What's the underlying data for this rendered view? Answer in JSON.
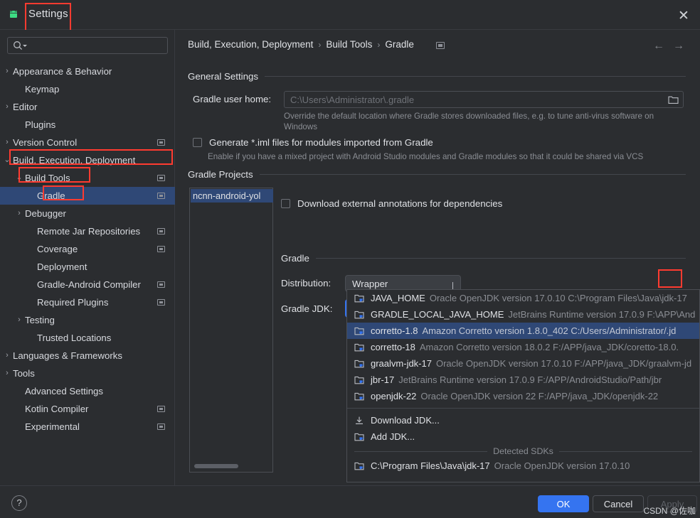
{
  "window": {
    "title": "Settings",
    "close_label": "✕",
    "app_icon": "android-logo-icon"
  },
  "search": {
    "placeholder": "",
    "value": ""
  },
  "sidebar": {
    "items": [
      {
        "label": "Appearance & Behavior",
        "arrow": "›",
        "indent": 18,
        "page_icon": false,
        "selected": false
      },
      {
        "label": "Keymap",
        "arrow": "",
        "indent": 35,
        "page_icon": false,
        "selected": false
      },
      {
        "label": "Editor",
        "arrow": "›",
        "indent": 18,
        "page_icon": false,
        "selected": false
      },
      {
        "label": "Plugins",
        "arrow": "",
        "indent": 35,
        "page_icon": false,
        "selected": false
      },
      {
        "label": "Version Control",
        "arrow": "›",
        "indent": 18,
        "page_icon": true,
        "selected": false
      },
      {
        "label": "Build, Execution, Deployment",
        "arrow": "⌄",
        "indent": 18,
        "page_icon": false,
        "selected": false
      },
      {
        "label": "Build Tools",
        "arrow": "⌄",
        "indent": 35,
        "page_icon": true,
        "selected": false
      },
      {
        "label": "Gradle",
        "arrow": "",
        "indent": 52,
        "page_icon": true,
        "selected": true
      },
      {
        "label": "Debugger",
        "arrow": "›",
        "indent": 35,
        "page_icon": false,
        "selected": false
      },
      {
        "label": "Remote Jar Repositories",
        "arrow": "",
        "indent": 52,
        "page_icon": true,
        "selected": false
      },
      {
        "label": "Coverage",
        "arrow": "",
        "indent": 52,
        "page_icon": true,
        "selected": false
      },
      {
        "label": "Deployment",
        "arrow": "",
        "indent": 52,
        "page_icon": false,
        "selected": false
      },
      {
        "label": "Gradle-Android Compiler",
        "arrow": "",
        "indent": 52,
        "page_icon": true,
        "selected": false
      },
      {
        "label": "Required Plugins",
        "arrow": "",
        "indent": 52,
        "page_icon": true,
        "selected": false
      },
      {
        "label": "Testing",
        "arrow": "›",
        "indent": 35,
        "page_icon": false,
        "selected": false
      },
      {
        "label": "Trusted Locations",
        "arrow": "",
        "indent": 52,
        "page_icon": false,
        "selected": false
      },
      {
        "label": "Languages & Frameworks",
        "arrow": "›",
        "indent": 18,
        "page_icon": false,
        "selected": false
      },
      {
        "label": "Tools",
        "arrow": "›",
        "indent": 18,
        "page_icon": false,
        "selected": false
      },
      {
        "label": "Advanced Settings",
        "arrow": "",
        "indent": 35,
        "page_icon": false,
        "selected": false
      },
      {
        "label": "Kotlin Compiler",
        "arrow": "",
        "indent": 35,
        "page_icon": true,
        "selected": false
      },
      {
        "label": "Experimental",
        "arrow": "",
        "indent": 35,
        "page_icon": true,
        "selected": false
      }
    ]
  },
  "breadcrumb": {
    "crumb1": "Build, Execution, Deployment",
    "sep1": "›",
    "crumb2": "Build Tools",
    "sep2": "›",
    "crumb3": "Gradle",
    "back": "←",
    "forward": "→"
  },
  "general": {
    "section_title": "General Settings",
    "home_label": "Gradle user home:",
    "home_value": "C:\\Users\\Administrator\\.gradle",
    "home_hint": "Override the default location where Gradle stores downloaded files, e.g. to tune anti-virus software on Windows",
    "iml_checkbox": "Generate *.iml files for modules imported from Gradle",
    "iml_hint": "Enable if you have a mixed project with Android Studio modules and Gradle modules so that it could be shared via VCS"
  },
  "projects": {
    "section_title": "Gradle Projects",
    "selected_item": "ncnn-android-yol",
    "annotations_checkbox": "Download external annotations for dependencies"
  },
  "gradle": {
    "section_title": "Gradle",
    "distribution_label": "Distribution:",
    "distribution_value": "Wrapper",
    "jdk_label": "Gradle JDK:",
    "jdk_value_name": "corretto-1.8",
    "jdk_value_desc": "Amazon Corretto version 1.8.0_402 C:/Users/Adminis"
  },
  "jdk_dropdown": {
    "options": [
      {
        "name": "JAVA_HOME",
        "desc": "Oracle OpenJDK version 17.0.10 C:\\Program Files\\Java\\jdk-17",
        "icon": "jdk-icon",
        "highlighted": false
      },
      {
        "name": "GRADLE_LOCAL_JAVA_HOME",
        "desc": "JetBrains Runtime version 17.0.9 F:\\APP\\And",
        "icon": "jdk-icon",
        "highlighted": false
      },
      {
        "name": "corretto-1.8",
        "desc": "Amazon Corretto version 1.8.0_402 C:/Users/Administrator/.jd",
        "icon": "jdk-icon",
        "highlighted": true
      },
      {
        "name": "corretto-18",
        "desc": "Amazon Corretto version 18.0.2 F:/APP/java_JDK/coretto-18.0.",
        "icon": "jdk-icon",
        "highlighted": false
      },
      {
        "name": "graalvm-jdk-17",
        "desc": "Oracle OpenJDK version 17.0.10 F:/APP/java_JDK/graalvm-jd",
        "icon": "jdk-icon",
        "highlighted": false
      },
      {
        "name": "jbr-17",
        "desc": "JetBrains Runtime version 17.0.9 F:/APP/AndroidStudio/Path/jbr",
        "icon": "jdk-icon",
        "highlighted": false
      },
      {
        "name": "openjdk-22",
        "desc": "Oracle OpenJDK version 22 F:/APP/java_JDK/openjdk-22",
        "icon": "jdk-icon",
        "highlighted": false
      }
    ],
    "download_jdk": "Download JDK...",
    "add_jdk": "Add JDK...",
    "detected_header": "Detected SDKs",
    "detected": [
      {
        "name": "C:\\Program Files\\Java\\jdk-17",
        "desc": "Oracle OpenJDK version 17.0.10",
        "icon": "jdk-icon"
      }
    ]
  },
  "footer": {
    "help": "?",
    "ok": "OK",
    "cancel": "Cancel",
    "apply": "Apply",
    "watermark": "CSDN @佐咖"
  },
  "colors": {
    "accent_blue": "#3574f0",
    "selection_blue": "#2f4876",
    "annotation_red": "#ff3b30",
    "panel_bg": "#2b2d30",
    "text": "#dfe1e5",
    "dim_text": "#8a8d93"
  }
}
